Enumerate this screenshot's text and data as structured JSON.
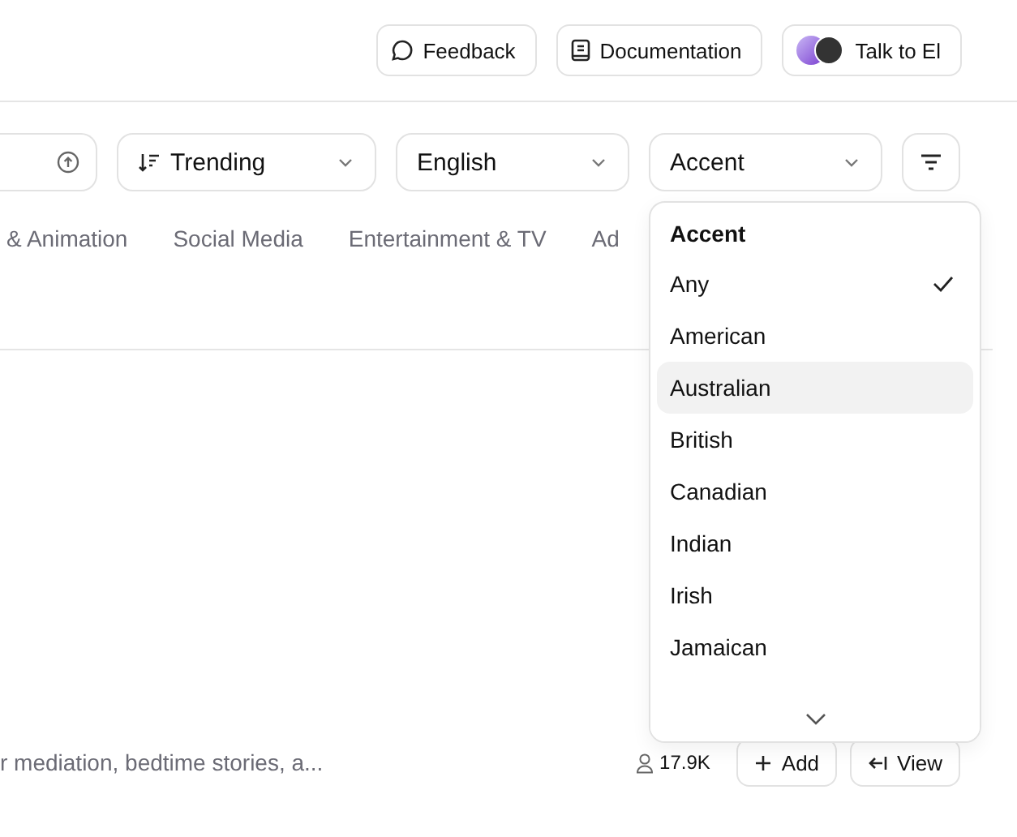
{
  "header": {
    "buttons": [
      {
        "kind": "feedback",
        "label": "Feedback"
      },
      {
        "kind": "docs",
        "label": "Documentation"
      },
      {
        "kind": "talk",
        "label": "Talk to El"
      }
    ]
  },
  "filters": {
    "sort": "Trending",
    "language": "English",
    "accent": "Accent"
  },
  "categories": [
    "& Animation",
    "Social Media",
    "Entertainment & TV",
    "Ad"
  ],
  "accent_menu": {
    "title": "Accent",
    "options": [
      {
        "label": "Any",
        "checked": true,
        "selected": false
      },
      {
        "label": "American",
        "checked": false,
        "selected": false
      },
      {
        "label": "Australian",
        "checked": false,
        "selected": true
      },
      {
        "label": "British",
        "checked": false,
        "selected": false
      },
      {
        "label": "Canadian",
        "checked": false,
        "selected": false
      },
      {
        "label": "Indian",
        "checked": false,
        "selected": false
      },
      {
        "label": "Irish",
        "checked": false,
        "selected": false
      },
      {
        "label": "Jamaican",
        "checked": false,
        "selected": false
      }
    ]
  },
  "voice_row": {
    "description": "r mediation, bedtime stories, a...",
    "users": "17.9K",
    "add": "Add",
    "view": "View"
  }
}
